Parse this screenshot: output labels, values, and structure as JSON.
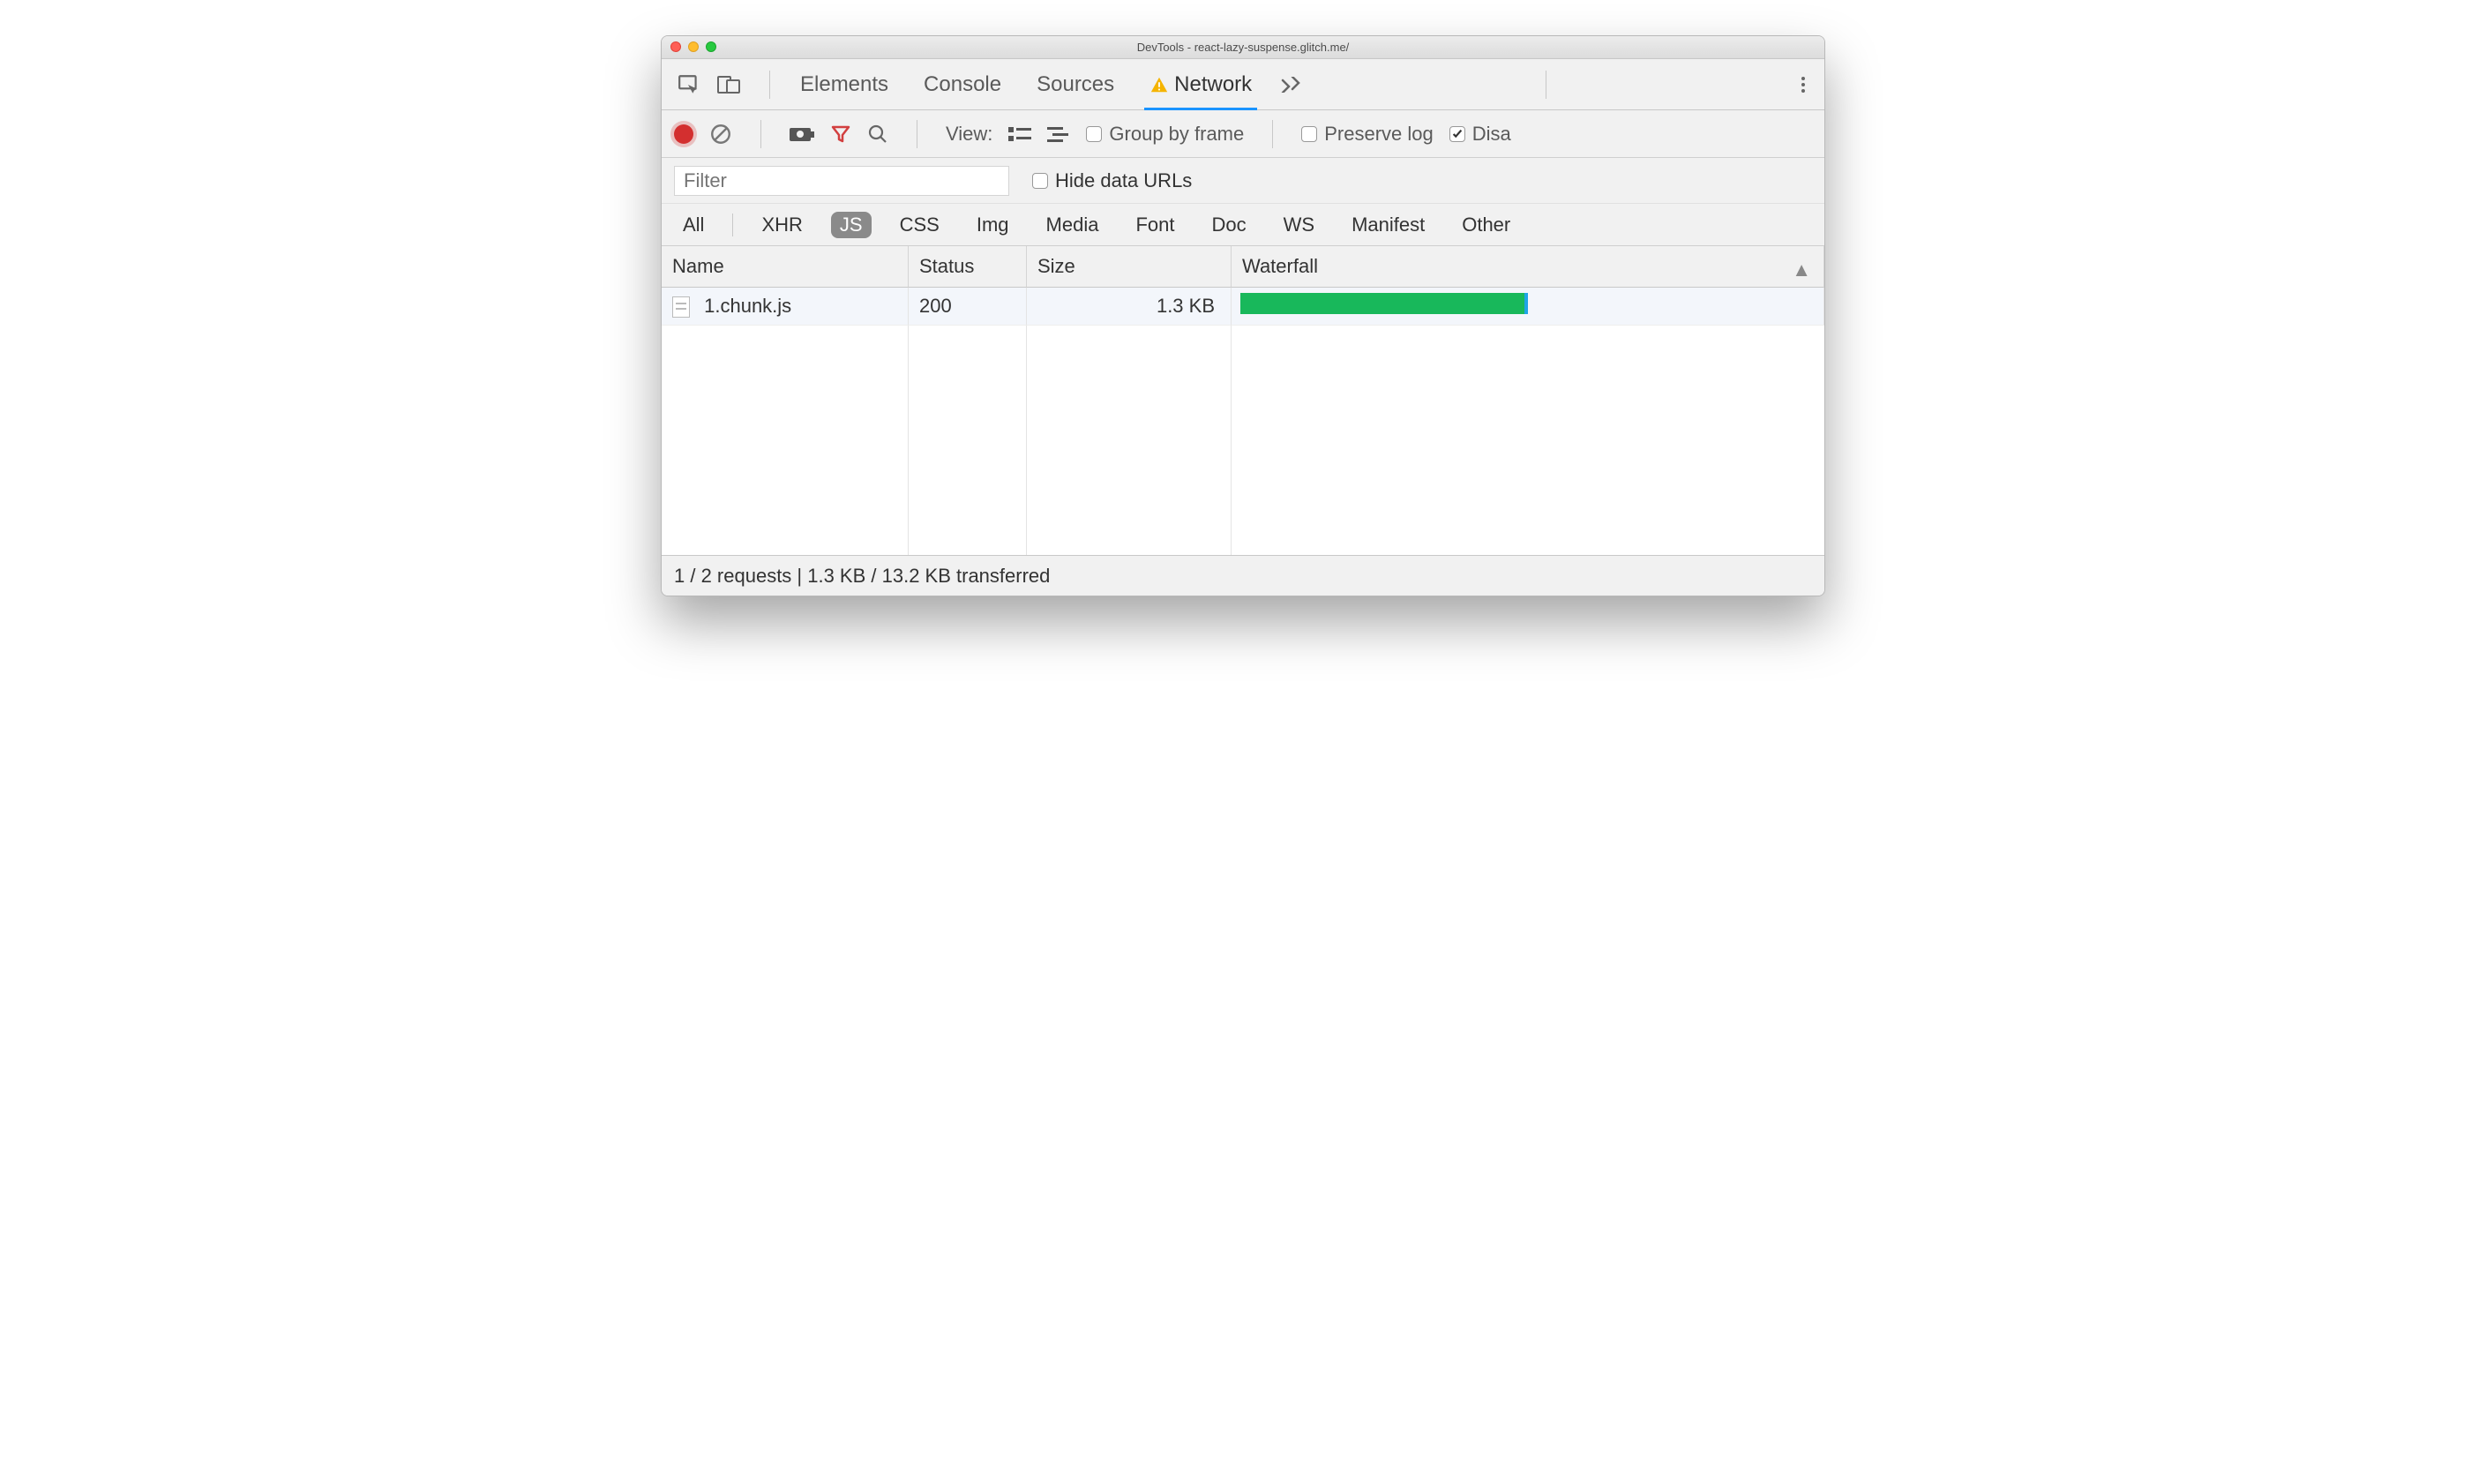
{
  "window": {
    "title": "DevTools - react-lazy-suspense.glitch.me/"
  },
  "tabs": {
    "elements": "Elements",
    "console": "Console",
    "sources": "Sources",
    "network": "Network"
  },
  "toolbar": {
    "view_label": "View:",
    "group_by_frame": "Group by frame",
    "preserve_log": "Preserve log",
    "disable_cache_partial": "Disa"
  },
  "filter": {
    "placeholder": "Filter",
    "hide_data_urls": "Hide data URLs"
  },
  "types": {
    "all": "All",
    "xhr": "XHR",
    "js": "JS",
    "css": "CSS",
    "img": "Img",
    "media": "Media",
    "font": "Font",
    "doc": "Doc",
    "ws": "WS",
    "manifest": "Manifest",
    "other": "Other"
  },
  "table": {
    "columns": {
      "name": "Name",
      "status": "Status",
      "size": "Size",
      "waterfall": "Waterfall"
    },
    "rows": [
      {
        "name": "1.chunk.js",
        "status": "200",
        "size": "1.3 KB"
      }
    ]
  },
  "status_bar": "1 / 2 requests | 1.3 KB / 13.2 KB transferred"
}
